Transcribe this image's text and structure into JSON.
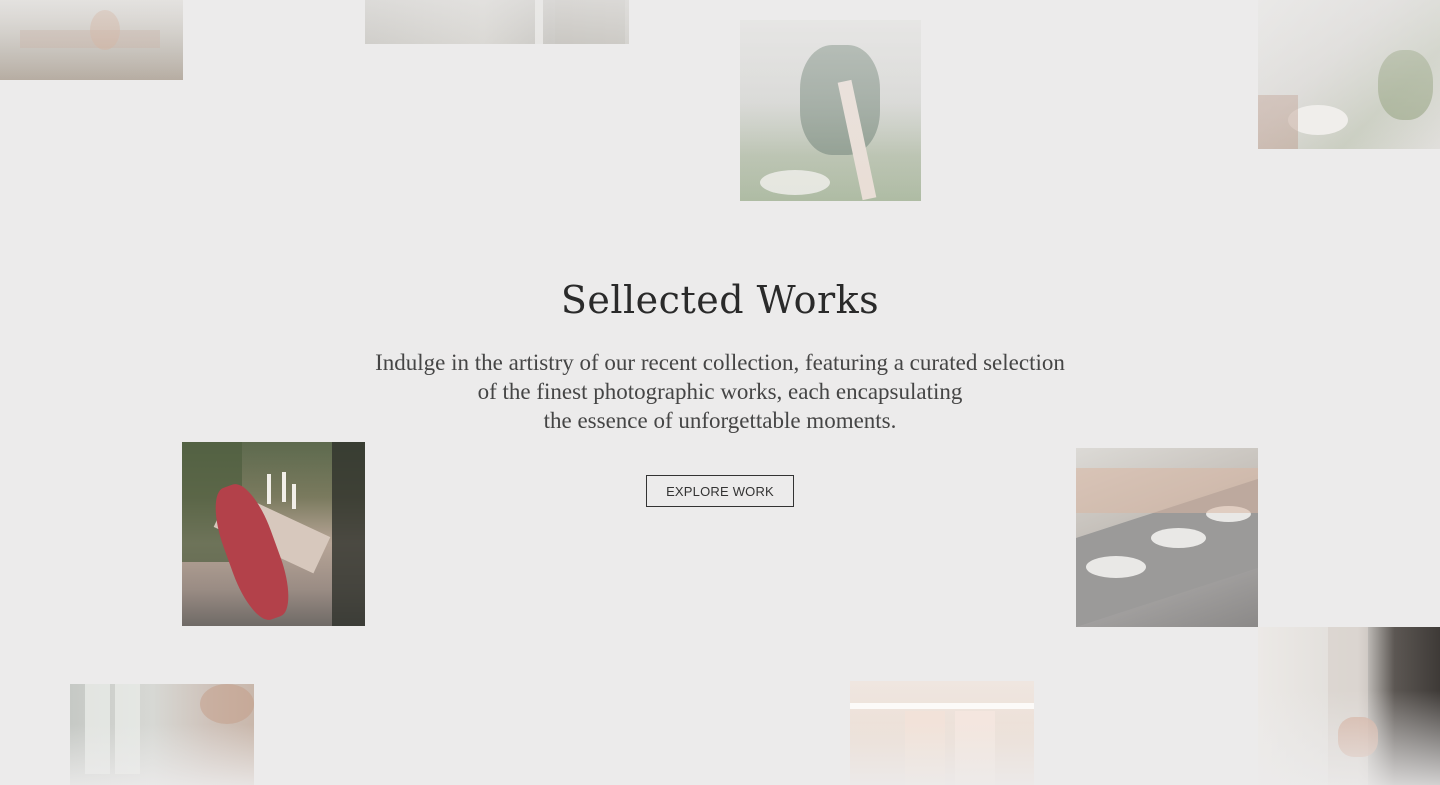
{
  "hero": {
    "title": "Sellected Works",
    "description_lines": [
      "Indulge in the artistry of our recent collection, featuring a curated selection",
      "of the finest photographic works, each encapsulating",
      "the essence of unforgettable moments."
    ],
    "cta_label": "EXPLORE WORK"
  },
  "gallery": {
    "tiles": [
      {
        "name": "wedding-table-photo",
        "icon": "photo-icon"
      },
      {
        "name": "ceremony-aisle-photo",
        "icon": "photo-icon"
      },
      {
        "name": "floral-chair-photo",
        "icon": "photo-icon"
      },
      {
        "name": "table-setting-photo",
        "icon": "photo-icon"
      },
      {
        "name": "red-floral-table-photo",
        "icon": "photo-icon"
      },
      {
        "name": "dinner-table-photo",
        "icon": "photo-icon"
      },
      {
        "name": "couple-hands-photo",
        "icon": "photo-icon"
      },
      {
        "name": "glassware-photo",
        "icon": "photo-icon"
      },
      {
        "name": "dresses-photo",
        "icon": "photo-icon"
      }
    ]
  },
  "colors": {
    "background": "#ecebeb",
    "text": "#2a2a2a",
    "button_border": "#333333"
  }
}
